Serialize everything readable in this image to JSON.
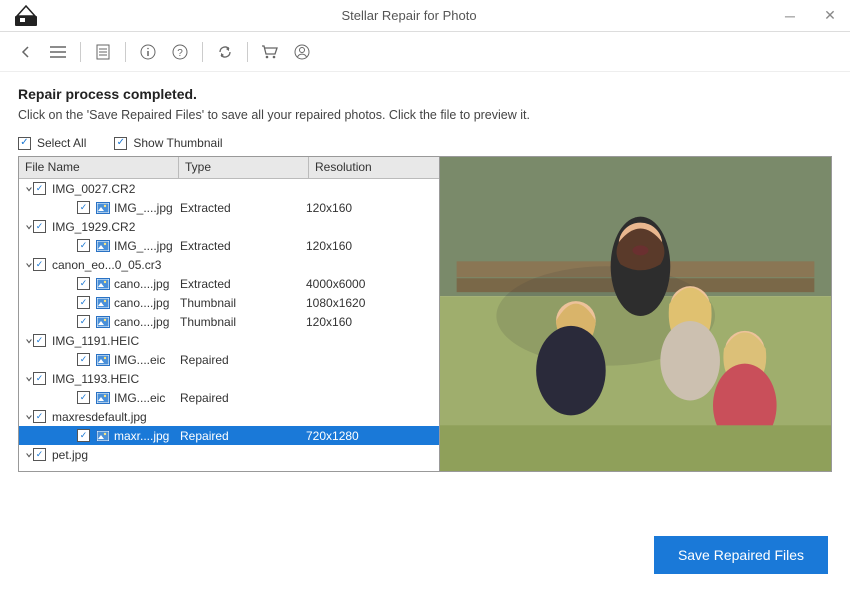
{
  "window": {
    "title": "Stellar Repair for Photo"
  },
  "page": {
    "heading": "Repair process completed.",
    "subheading": "Click on the 'Save Repaired Files' to save all your repaired photos. Click the file to preview it."
  },
  "options": {
    "select_all_label": "Select All",
    "show_thumbnail_label": "Show Thumbnail"
  },
  "columns": {
    "name": "File Name",
    "type": "Type",
    "res": "Resolution"
  },
  "tree": [
    {
      "kind": "parent",
      "expanded": true,
      "checked": true,
      "name": "IMG_0027.CR2"
    },
    {
      "kind": "leaf",
      "checked": true,
      "name": "IMG_....jpg",
      "type": "Extracted",
      "res": "120x160"
    },
    {
      "kind": "parent",
      "expanded": true,
      "checked": true,
      "name": "IMG_1929.CR2"
    },
    {
      "kind": "leaf",
      "checked": true,
      "name": "IMG_....jpg",
      "type": "Extracted",
      "res": "120x160"
    },
    {
      "kind": "parent",
      "expanded": true,
      "checked": true,
      "name": "canon_eo...0_05.cr3"
    },
    {
      "kind": "leaf",
      "checked": true,
      "name": "cano....jpg",
      "type": "Extracted",
      "res": "4000x6000"
    },
    {
      "kind": "leaf",
      "checked": true,
      "name": "cano....jpg",
      "type": "Thumbnail",
      "res": "1080x1620"
    },
    {
      "kind": "leaf",
      "checked": true,
      "name": "cano....jpg",
      "type": "Thumbnail",
      "res": "120x160"
    },
    {
      "kind": "parent",
      "expanded": true,
      "checked": true,
      "name": "IMG_1191.HEIC"
    },
    {
      "kind": "leaf",
      "checked": true,
      "name": "IMG....eic",
      "type": "Repaired",
      "res": ""
    },
    {
      "kind": "parent",
      "expanded": true,
      "checked": true,
      "name": "IMG_1193.HEIC"
    },
    {
      "kind": "leaf",
      "checked": true,
      "name": "IMG....eic",
      "type": "Repaired",
      "res": ""
    },
    {
      "kind": "parent",
      "expanded": true,
      "checked": true,
      "name": "maxresdefault.jpg"
    },
    {
      "kind": "leaf",
      "checked": true,
      "name": "maxr....jpg",
      "type": "Repaired",
      "res": "720x1280",
      "selected": true
    },
    {
      "kind": "parent",
      "expanded": true,
      "checked": true,
      "name": "pet.jpg"
    }
  ],
  "actions": {
    "save_label": "Save Repaired Files"
  }
}
